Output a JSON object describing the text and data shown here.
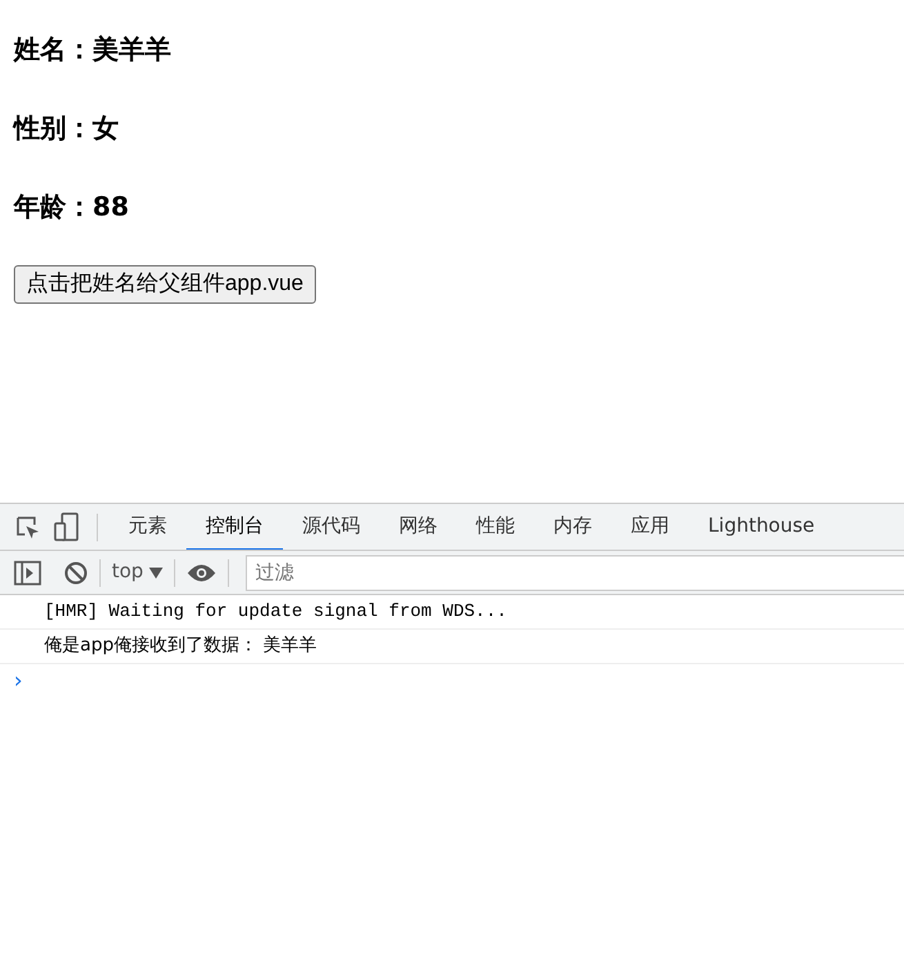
{
  "fields": [
    {
      "label": "姓名：美羊羊"
    },
    {
      "label": "性别：女"
    },
    {
      "label": "年龄：88"
    }
  ],
  "button": "点击把姓名给父组件app.vue",
  "devtools": {
    "tabs": [
      {
        "label": "元素",
        "selected": false
      },
      {
        "label": "控制台",
        "selected": true
      },
      {
        "label": "源代码",
        "selected": false
      },
      {
        "label": "网络",
        "selected": false
      },
      {
        "label": "性能",
        "selected": false
      },
      {
        "label": "内存",
        "selected": false
      },
      {
        "label": "应用",
        "selected": false
      },
      {
        "label": "Lighthouse",
        "selected": false
      }
    ],
    "context": "top",
    "filter_placeholder": "过滤",
    "messages": [
      {
        "text": "[HMR] Waiting for update signal from WDS...",
        "kind": "mono"
      },
      {
        "text": "俺是app俺接收到了数据： 美羊羊",
        "kind": "plain"
      }
    ],
    "prompt": "›"
  }
}
